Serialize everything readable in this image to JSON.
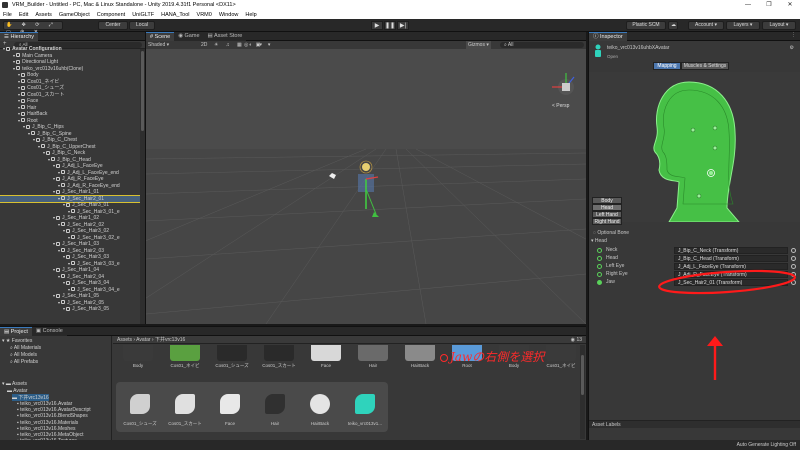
{
  "window": {
    "title": "VRM_Builder - Untitled - PC, Mac & Linux Standalone - Unity 2019.4.31f1 Personal <DX11>",
    "min": "—",
    "max": "❐",
    "close": "✕"
  },
  "menu": [
    "File",
    "Edit",
    "Assets",
    "GameObject",
    "Component",
    "UniGLTF",
    "HANA_Tool",
    "VRM0",
    "Window",
    "Help"
  ],
  "toolbar": {
    "center": "Center",
    "local": "Local",
    "plastic": "Plastic SCM",
    "account": "Account",
    "layers": "Layers",
    "layout": "Layout"
  },
  "hierarchy": {
    "tab": "Hierarchy",
    "add": "+",
    "search": "All",
    "rows": [
      {
        "t": "Avatar Configuration",
        "d": 0,
        "bold": true
      },
      {
        "t": "Main Camera",
        "d": 2
      },
      {
        "t": "Directional Light",
        "d": 2
      },
      {
        "t": "teiko_vrc013v16uhb(Clone)",
        "d": 2
      },
      {
        "t": "Body",
        "d": 3
      },
      {
        "t": "Cos01_ネイビ",
        "d": 3
      },
      {
        "t": "Cos01_シューズ",
        "d": 3
      },
      {
        "t": "Cos01_スカート",
        "d": 3
      },
      {
        "t": "Face",
        "d": 3
      },
      {
        "t": "Hair",
        "d": 3
      },
      {
        "t": "HairBack",
        "d": 3
      },
      {
        "t": "Root",
        "d": 3
      },
      {
        "t": "J_Bip_C_Hips",
        "d": 4
      },
      {
        "t": "J_Bip_C_Spine",
        "d": 5
      },
      {
        "t": "J_Bip_C_Chest",
        "d": 6
      },
      {
        "t": "J_Bip_C_UpperChest",
        "d": 7
      },
      {
        "t": "J_Bip_C_Neck",
        "d": 8
      },
      {
        "t": "J_Bip_C_Head",
        "d": 9
      },
      {
        "t": "J_Adj_L_FaceEye",
        "d": 10
      },
      {
        "t": "J_Adj_L_FaceEye_end",
        "d": 11
      },
      {
        "t": "J_Adj_R_FaceEye",
        "d": 10
      },
      {
        "t": "J_Adj_R_FaceEye_end",
        "d": 11
      },
      {
        "t": "J_Sec_Hair1_01",
        "d": 10
      },
      {
        "t": "J_Sec_Hair2_01",
        "d": 11,
        "sel": true
      },
      {
        "t": "J_Sec_Hair3_01",
        "d": 12
      },
      {
        "t": "J_Sec_Hair3_01_e",
        "d": 13
      },
      {
        "t": "J_Sec_Hair1_02",
        "d": 10
      },
      {
        "t": "J_Sec_Hair2_02",
        "d": 11
      },
      {
        "t": "J_Sec_Hair3_02",
        "d": 12
      },
      {
        "t": "J_Sec_Hair3_02_e",
        "d": 13
      },
      {
        "t": "J_Sec_Hair1_03",
        "d": 10
      },
      {
        "t": "J_Sec_Hair2_03",
        "d": 11
      },
      {
        "t": "J_Sec_Hair3_03",
        "d": 12
      },
      {
        "t": "J_Sec_Hair3_03_e",
        "d": 13
      },
      {
        "t": "J_Sec_Hair1_04",
        "d": 10
      },
      {
        "t": "J_Sec_Hair2_04",
        "d": 11
      },
      {
        "t": "J_Sec_Hair3_04",
        "d": 12
      },
      {
        "t": "J_Sec_Hair3_04_e",
        "d": 13
      },
      {
        "t": "J_Sec_Hair1_05",
        "d": 10
      },
      {
        "t": "J_Sec_Hair2_05",
        "d": 11
      },
      {
        "t": "J_Sec_Hair3_05",
        "d": 12
      }
    ]
  },
  "scene": {
    "tabs": [
      "Scene",
      "Game",
      "Asset Store"
    ],
    "shading": "Shaded",
    "mode2d": "2D",
    "gizmos": "Gizmos",
    "search": "All",
    "persp": "< Persp"
  },
  "inspector": {
    "tab": "Inspector",
    "object": "teiko_vrc013v16uhbXAvatar",
    "open": "Open",
    "mapping": "Mapping",
    "muscles": "Muscles & Settings",
    "bodybtns": [
      "Body",
      "Head",
      "Left Hand",
      "Right Hand"
    ],
    "optional": "Optional Bone",
    "section": "Head",
    "bones": [
      {
        "n": "Neck",
        "v": "J_Bip_C_Neck (Transform)"
      },
      {
        "n": "Head",
        "v": "J_Bip_C_Head (Transform)"
      },
      {
        "n": "Left Eye",
        "v": "J_Adj_L_FaceEye (Transform)"
      },
      {
        "n": "Right Eye",
        "v": "J_Adj_R_FaceEye (Transform)"
      },
      {
        "n": "Jaw",
        "v": "J_Sec_Hair2_01 (Transform)"
      }
    ],
    "annotation": "Jawの右側を選択",
    "assetlabels": "Asset Labels"
  },
  "project": {
    "tabs": [
      "Project",
      "Console"
    ],
    "favorites": "Favorites",
    "fav": [
      "All Materials",
      "All Models",
      "All Prefabs"
    ],
    "assets": "Assets",
    "tree": [
      {
        "t": "Avatar",
        "d": 1
      },
      {
        "t": "下井vrc13v16",
        "d": 2
      },
      {
        "t": "teiko_vrc013v16.Avatar",
        "d": 3
      },
      {
        "t": "teiko_vrc013v16.AvatarDescript",
        "d": 3
      },
      {
        "t": "teiko_vrc013v16.BlendShapes",
        "d": 3
      },
      {
        "t": "teiko_vrc013v16.Materials",
        "d": 3
      },
      {
        "t": "teiko_vrc013v16.Meshes",
        "d": 3
      },
      {
        "t": "teiko_vrc013v16.MetaObject",
        "d": 3
      },
      {
        "t": "teiko_vrc013v16.Textures",
        "d": 3
      }
    ],
    "breadcrumb": "Assets › Avatar › 下井vrc13v16",
    "count": "13",
    "row1": [
      "Body",
      "Cos01_ネイビ",
      "Cos01_シューズ",
      "Cos01_スカート",
      "Face",
      "Hair",
      "HairBack",
      "Root",
      "Body",
      "Cos01_ネイビ"
    ],
    "row2": [
      "Cos01_シューズ",
      "Cos01_スカート",
      "Face",
      "Hair",
      "HairBack",
      "teiko_vrc013v1..."
    ]
  },
  "status": "Auto Generate Lighting Off"
}
